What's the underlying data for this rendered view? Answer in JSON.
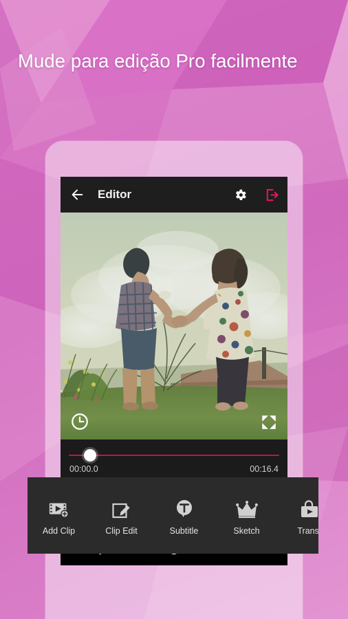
{
  "promo": {
    "headline": "Mude para edição Pro facilmente"
  },
  "colors": {
    "accent_pink": "#e8175d",
    "track_pink": "#c2134a",
    "background_magenta": "#cf66bb",
    "appbar_dark": "#1e1e1e",
    "panel_dark": "#2b2b2b"
  },
  "app": {
    "appbar": {
      "back_icon": "back-arrow-icon",
      "title": "Editor",
      "settings_icon": "gear-icon",
      "export_icon": "export-icon"
    },
    "preview": {
      "clock_icon": "clock-icon",
      "fullscreen_icon": "fullscreen-icon",
      "alt": "Two children holding hands in a grassy field under a cloudy sky"
    },
    "timeline": {
      "current_time": "00:00.0",
      "total_time": "00:16.4",
      "progress_percent": 9,
      "handle_icon": "playhead-handle"
    },
    "toolbar": {
      "items": [
        {
          "label": "Add Clip",
          "icon": "add-clip-icon"
        },
        {
          "label": "Clip Edit",
          "icon": "clip-edit-icon"
        },
        {
          "label": "Subtitle",
          "icon": "subtitle-icon"
        },
        {
          "label": "Sketch",
          "icon": "crown-icon"
        },
        {
          "label": "Transi",
          "icon": "transition-icon"
        }
      ]
    },
    "navbar": {
      "back": "nav-back-icon",
      "home": "nav-home-icon",
      "recents": "nav-recents-icon"
    }
  }
}
